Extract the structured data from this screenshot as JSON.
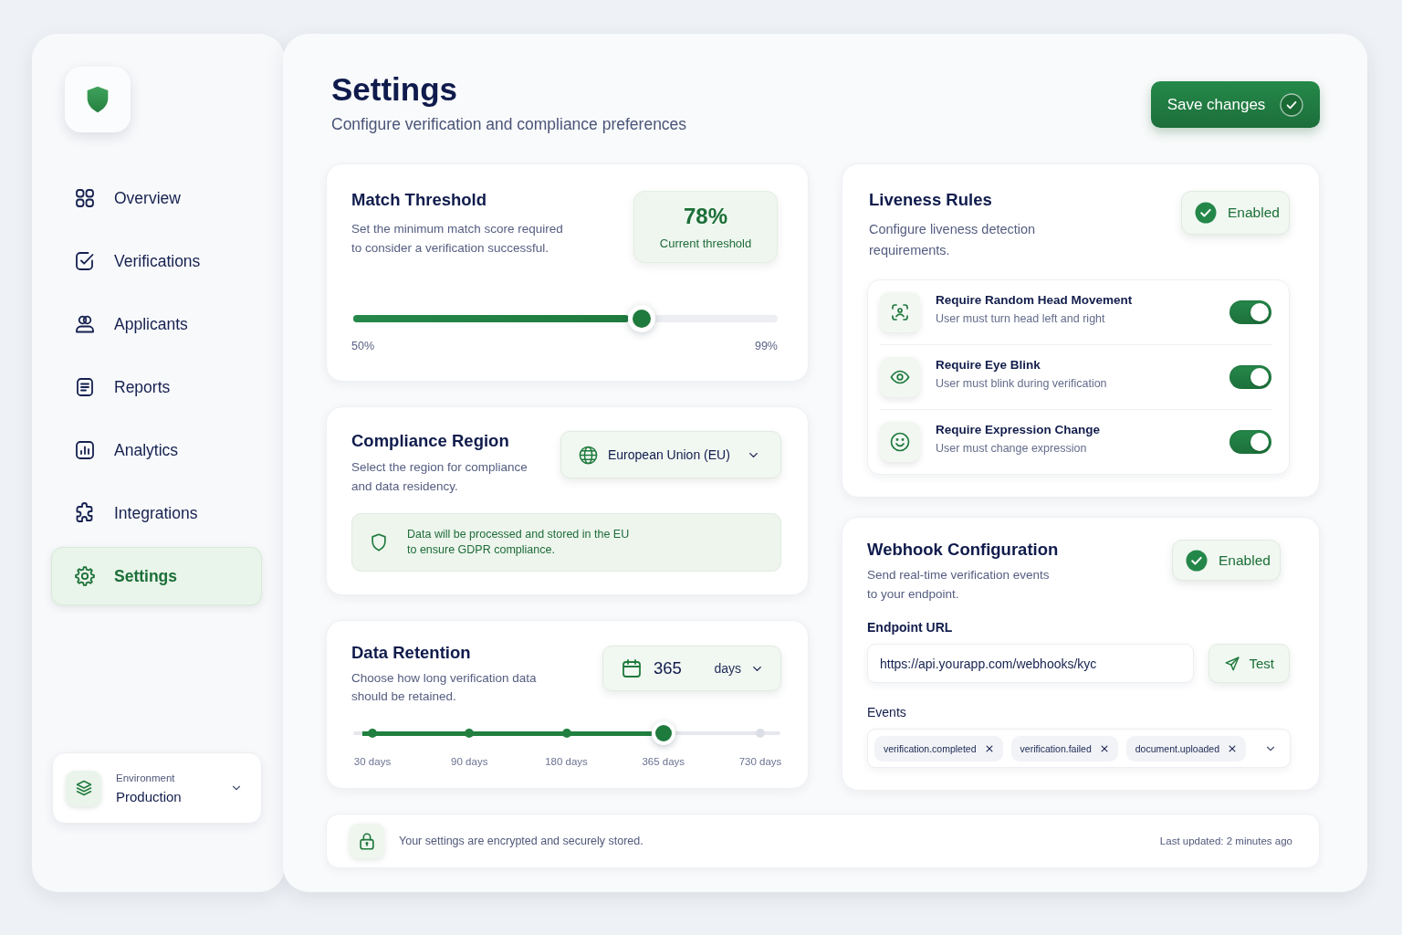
{
  "sidebar": {
    "nav": [
      {
        "label": "Overview",
        "selected": false
      },
      {
        "label": "Verifications",
        "selected": false
      },
      {
        "label": "Applicants",
        "selected": false
      },
      {
        "label": "Reports",
        "selected": false
      },
      {
        "label": "Analytics",
        "selected": false
      },
      {
        "label": "Integrations",
        "selected": false
      },
      {
        "label": "Settings",
        "selected": true
      }
    ],
    "environment": {
      "label": "Environment",
      "value": "Production"
    }
  },
  "header": {
    "title": "Settings",
    "subtitle": "Configure verification and compliance preferences",
    "save_button": "Save changes"
  },
  "match_threshold": {
    "title": "Match Threshold",
    "description": "Set the minimum match score required\nto consider a verification successful.",
    "value": "78%",
    "caption": "Current threshold",
    "level": 0.68,
    "min_label": "50%",
    "max_label": "99%"
  },
  "compliance_region": {
    "title": "Compliance Region",
    "description": "Select the region for compliance\nand data residency.",
    "region": "European Union (EU)",
    "notice": "Data will be processed and stored in the EU\nto ensure GDPR compliance."
  },
  "data_retention": {
    "title": "Data Retention",
    "description": "Choose how long verification data\nshould be retained.",
    "value": "365",
    "unit": "days",
    "level": 0.75,
    "stops": [
      "30 days",
      "90 days",
      "180 days",
      "365 days",
      "730 days"
    ]
  },
  "liveness_rules": {
    "title": "Liveness Rules",
    "description": "Configure liveness detection\nrequirements.",
    "status": {
      "label": "Enabled",
      "on": true
    },
    "rules": [
      {
        "title": "Require Random Head Movement",
        "description": "User must turn head left and right",
        "on": true
      },
      {
        "title": "Require Eye Blink",
        "description": "User must blink during verification",
        "on": true
      },
      {
        "title": "Require Expression Change",
        "description": "User must change expression",
        "on": true
      }
    ]
  },
  "webhook": {
    "title": "Webhook Configuration",
    "description": "Send real-time verification events\nto your endpoint.",
    "status": {
      "label": "Enabled",
      "on": true
    },
    "endpoint_label": "Endpoint URL",
    "endpoint_url": "https://api.yourapp.com/webhooks/kyc",
    "test_button": "Test",
    "events_label": "Events",
    "events": [
      "verification.completed",
      "verification.failed",
      "document.uploaded"
    ]
  },
  "footer": {
    "note": "Your settings are encrypted and securely stored.",
    "updated": "Last updated: 2 minutes ago"
  }
}
